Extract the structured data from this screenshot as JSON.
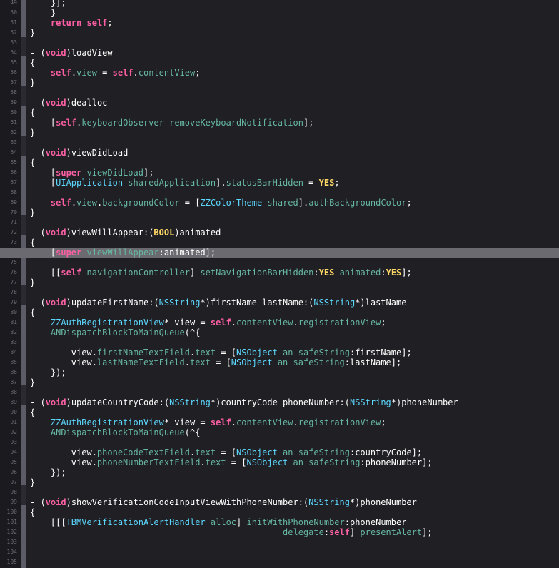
{
  "editor": {
    "current_line": 74,
    "lines": [
      {
        "n": "49",
        "t": [
          {
            "s": "    }];"
          }
        ]
      },
      {
        "n": "50",
        "t": [
          {
            "s": "    }"
          }
        ]
      },
      {
        "n": "51",
        "t": [
          {
            "s": "    "
          },
          {
            "s": "return",
            "c": "kw"
          },
          {
            "s": " "
          },
          {
            "s": "self",
            "c": "kw"
          },
          {
            "s": ";"
          }
        ]
      },
      {
        "n": "52",
        "t": [
          {
            "s": "}"
          }
        ]
      },
      {
        "n": "53",
        "t": []
      },
      {
        "n": "54",
        "t": [
          {
            "s": "- ("
          },
          {
            "s": "void",
            "c": "kw"
          },
          {
            "s": ")loadView"
          }
        ]
      },
      {
        "n": "55",
        "t": [
          {
            "s": "{"
          }
        ]
      },
      {
        "n": "56",
        "t": [
          {
            "s": "    "
          },
          {
            "s": "self",
            "c": "kw"
          },
          {
            "s": "."
          },
          {
            "s": "view",
            "c": "prop"
          },
          {
            "s": " = "
          },
          {
            "s": "self",
            "c": "kw"
          },
          {
            "s": "."
          },
          {
            "s": "contentView",
            "c": "prop"
          },
          {
            "s": ";"
          }
        ]
      },
      {
        "n": "57",
        "t": [
          {
            "s": "}"
          }
        ]
      },
      {
        "n": "58",
        "t": []
      },
      {
        "n": "59",
        "t": [
          {
            "s": "- ("
          },
          {
            "s": "void",
            "c": "kw"
          },
          {
            "s": ")dealloc"
          }
        ]
      },
      {
        "n": "60",
        "t": [
          {
            "s": "{"
          }
        ]
      },
      {
        "n": "61",
        "t": [
          {
            "s": "    ["
          },
          {
            "s": "self",
            "c": "kw"
          },
          {
            "s": "."
          },
          {
            "s": "keyboardObserver",
            "c": "prop"
          },
          {
            "s": " "
          },
          {
            "s": "removeKeyboardNotification",
            "c": "meth"
          },
          {
            "s": "];"
          }
        ]
      },
      {
        "n": "62",
        "t": [
          {
            "s": "}"
          }
        ]
      },
      {
        "n": "63",
        "t": []
      },
      {
        "n": "64",
        "t": [
          {
            "s": "- ("
          },
          {
            "s": "void",
            "c": "kw"
          },
          {
            "s": ")viewDidLoad"
          }
        ]
      },
      {
        "n": "65",
        "t": [
          {
            "s": "{"
          }
        ]
      },
      {
        "n": "66",
        "t": [
          {
            "s": "    ["
          },
          {
            "s": "super",
            "c": "kw"
          },
          {
            "s": " "
          },
          {
            "s": "viewDidLoad",
            "c": "meth"
          },
          {
            "s": "];"
          }
        ]
      },
      {
        "n": "67",
        "t": [
          {
            "s": "    ["
          },
          {
            "s": "UIApplication",
            "c": "cls"
          },
          {
            "s": " "
          },
          {
            "s": "sharedApplication",
            "c": "meth"
          },
          {
            "s": "]."
          },
          {
            "s": "statusBarHidden",
            "c": "prop"
          },
          {
            "s": " = "
          },
          {
            "s": "YES",
            "c": "lit"
          },
          {
            "s": ";"
          }
        ]
      },
      {
        "n": "68",
        "t": []
      },
      {
        "n": "69",
        "t": [
          {
            "s": "    "
          },
          {
            "s": "self",
            "c": "kw"
          },
          {
            "s": "."
          },
          {
            "s": "view",
            "c": "prop"
          },
          {
            "s": "."
          },
          {
            "s": "backgroundColor",
            "c": "prop"
          },
          {
            "s": " = ["
          },
          {
            "s": "ZZColorTheme",
            "c": "cls"
          },
          {
            "s": " "
          },
          {
            "s": "shared",
            "c": "meth"
          },
          {
            "s": "]."
          },
          {
            "s": "authBackgroundColor",
            "c": "prop"
          },
          {
            "s": ";"
          }
        ]
      },
      {
        "n": "70",
        "t": [
          {
            "s": "}"
          }
        ]
      },
      {
        "n": "71",
        "t": []
      },
      {
        "n": "72",
        "t": [
          {
            "s": "- ("
          },
          {
            "s": "void",
            "c": "kw"
          },
          {
            "s": ")viewWillAppear:("
          },
          {
            "s": "BOOL",
            "c": "lit"
          },
          {
            "s": ")animated"
          }
        ]
      },
      {
        "n": "73",
        "t": [
          {
            "s": "{"
          }
        ]
      },
      {
        "n": "74",
        "t": [
          {
            "s": "    ["
          },
          {
            "s": "super",
            "c": "kw"
          },
          {
            "s": " "
          },
          {
            "s": "viewWillAppear",
            "c": "meth"
          },
          {
            "s": ":animated];"
          }
        ]
      },
      {
        "n": "75",
        "t": []
      },
      {
        "n": "76",
        "t": [
          {
            "s": "    [["
          },
          {
            "s": "self",
            "c": "kw"
          },
          {
            "s": " "
          },
          {
            "s": "navigationController",
            "c": "meth"
          },
          {
            "s": "] "
          },
          {
            "s": "setNavigationBarHidden",
            "c": "meth"
          },
          {
            "s": ":"
          },
          {
            "s": "YES",
            "c": "lit"
          },
          {
            "s": " "
          },
          {
            "s": "animated",
            "c": "meth"
          },
          {
            "s": ":"
          },
          {
            "s": "YES",
            "c": "lit"
          },
          {
            "s": "];"
          }
        ]
      },
      {
        "n": "77",
        "t": [
          {
            "s": "}"
          }
        ]
      },
      {
        "n": "78",
        "t": []
      },
      {
        "n": "79",
        "t": [
          {
            "s": "- ("
          },
          {
            "s": "void",
            "c": "kw"
          },
          {
            "s": ")updateFirstName:("
          },
          {
            "s": "NSString",
            "c": "cls"
          },
          {
            "s": "*)firstName lastName:("
          },
          {
            "s": "NSString",
            "c": "cls"
          },
          {
            "s": "*)lastName"
          }
        ]
      },
      {
        "n": "80",
        "t": [
          {
            "s": "{"
          }
        ]
      },
      {
        "n": "81",
        "t": [
          {
            "s": "    "
          },
          {
            "s": "ZZAuthRegistrationView",
            "c": "cls"
          },
          {
            "s": "* view = "
          },
          {
            "s": "self",
            "c": "kw"
          },
          {
            "s": "."
          },
          {
            "s": "contentView",
            "c": "prop"
          },
          {
            "s": "."
          },
          {
            "s": "registrationView",
            "c": "prop"
          },
          {
            "s": ";"
          }
        ]
      },
      {
        "n": "82",
        "t": [
          {
            "s": "    "
          },
          {
            "s": "ANDispatchBlockToMainQueue",
            "c": "meth"
          },
          {
            "s": "(^{"
          }
        ]
      },
      {
        "n": "83",
        "t": []
      },
      {
        "n": "84",
        "t": [
          {
            "s": "        view."
          },
          {
            "s": "firstNameTextField",
            "c": "prop"
          },
          {
            "s": "."
          },
          {
            "s": "text",
            "c": "prop"
          },
          {
            "s": " = ["
          },
          {
            "s": "NSObject",
            "c": "cls"
          },
          {
            "s": " "
          },
          {
            "s": "an_safeString",
            "c": "meth"
          },
          {
            "s": ":firstName];"
          }
        ]
      },
      {
        "n": "85",
        "t": [
          {
            "s": "        view."
          },
          {
            "s": "lastNameTextField",
            "c": "prop"
          },
          {
            "s": "."
          },
          {
            "s": "text",
            "c": "prop"
          },
          {
            "s": " = ["
          },
          {
            "s": "NSObject",
            "c": "cls"
          },
          {
            "s": " "
          },
          {
            "s": "an_safeString",
            "c": "meth"
          },
          {
            "s": ":lastName];"
          }
        ]
      },
      {
        "n": "86",
        "t": [
          {
            "s": "    });"
          }
        ]
      },
      {
        "n": "87",
        "t": [
          {
            "s": "}"
          }
        ]
      },
      {
        "n": "88",
        "t": []
      },
      {
        "n": "89",
        "t": [
          {
            "s": "- ("
          },
          {
            "s": "void",
            "c": "kw"
          },
          {
            "s": ")updateCountryCode:("
          },
          {
            "s": "NSString",
            "c": "cls"
          },
          {
            "s": "*)countryCode phoneNumber:("
          },
          {
            "s": "NSString",
            "c": "cls"
          },
          {
            "s": "*)phoneNumber"
          }
        ]
      },
      {
        "n": "90",
        "t": [
          {
            "s": "{"
          }
        ]
      },
      {
        "n": "91",
        "t": [
          {
            "s": "    "
          },
          {
            "s": "ZZAuthRegistrationView",
            "c": "cls"
          },
          {
            "s": "* view = "
          },
          {
            "s": "self",
            "c": "kw"
          },
          {
            "s": "."
          },
          {
            "s": "contentView",
            "c": "prop"
          },
          {
            "s": "."
          },
          {
            "s": "registrationView",
            "c": "prop"
          },
          {
            "s": ";"
          }
        ]
      },
      {
        "n": "92",
        "t": [
          {
            "s": "    "
          },
          {
            "s": "ANDispatchBlockToMainQueue",
            "c": "meth"
          },
          {
            "s": "(^{"
          }
        ]
      },
      {
        "n": "93",
        "t": []
      },
      {
        "n": "94",
        "t": [
          {
            "s": "        view."
          },
          {
            "s": "phoneCodeTextField",
            "c": "prop"
          },
          {
            "s": "."
          },
          {
            "s": "text",
            "c": "prop"
          },
          {
            "s": " = ["
          },
          {
            "s": "NSObject",
            "c": "cls"
          },
          {
            "s": " "
          },
          {
            "s": "an_safeString",
            "c": "meth"
          },
          {
            "s": ":countryCode];"
          }
        ]
      },
      {
        "n": "95",
        "t": [
          {
            "s": "        view."
          },
          {
            "s": "phoneNumberTextField",
            "c": "prop"
          },
          {
            "s": "."
          },
          {
            "s": "text",
            "c": "prop"
          },
          {
            "s": " = ["
          },
          {
            "s": "NSObject",
            "c": "cls"
          },
          {
            "s": " "
          },
          {
            "s": "an_safeString",
            "c": "meth"
          },
          {
            "s": ":phoneNumber];"
          }
        ]
      },
      {
        "n": "96",
        "t": [
          {
            "s": "    });"
          }
        ]
      },
      {
        "n": "97",
        "t": [
          {
            "s": "}"
          }
        ]
      },
      {
        "n": "98",
        "t": []
      },
      {
        "n": "99",
        "t": [
          {
            "s": "- ("
          },
          {
            "s": "void",
            "c": "kw"
          },
          {
            "s": ")showVerificationCodeInputViewWithPhoneNumber:("
          },
          {
            "s": "NSString",
            "c": "cls"
          },
          {
            "s": "*)phoneNumber"
          }
        ]
      },
      {
        "n": "100",
        "t": [
          {
            "s": "{"
          }
        ]
      },
      {
        "n": "101",
        "t": [
          {
            "s": "    [[["
          },
          {
            "s": "TBMVerificationAlertHandler",
            "c": "cls"
          },
          {
            "s": " "
          },
          {
            "s": "alloc",
            "c": "meth"
          },
          {
            "s": "] "
          },
          {
            "s": "initWithPhoneNumber",
            "c": "meth"
          },
          {
            "s": ":phoneNumber"
          }
        ]
      },
      {
        "n": "102",
        "t": [
          {
            "s": "                                                 "
          },
          {
            "s": "delegate",
            "c": "meth"
          },
          {
            "s": ":"
          },
          {
            "s": "self",
            "c": "kw"
          },
          {
            "s": "] "
          },
          {
            "s": "presentAlert",
            "c": "meth"
          },
          {
            "s": "];"
          }
        ]
      },
      {
        "n": "103",
        "t": []
      },
      {
        "n": "104",
        "t": []
      },
      {
        "n": "105",
        "t": []
      }
    ]
  }
}
